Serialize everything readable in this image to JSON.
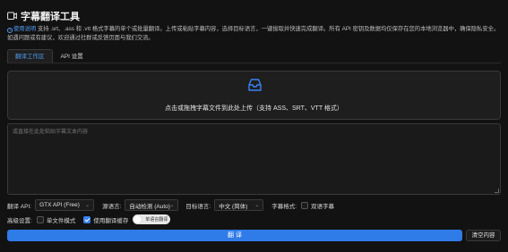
{
  "header": {
    "title": "字幕翻译工具",
    "icon": "subtitle-icon"
  },
  "description": {
    "help_link": "使用说明",
    "text": "支持 .srt、.ass 和 .vtt 格式字幕的单个或批量翻译。上传或粘贴字幕内容，选择目标语言，一键拔取并快速完成翻译。所有 API 密钥及数据均仅保存在您的本地浏览器中，确保隐私安全。如遇问题或有建议，欢迎通过社群或反馈页面与我们交流。"
  },
  "tabs": [
    {
      "label": "翻译工作区",
      "active": true
    },
    {
      "label": "API 设置",
      "active": false
    }
  ],
  "dropzone": {
    "text": "点击或拖拽字幕文件到此处上传（支持 ASS、SRT、VTT 格式）",
    "icon": "inbox-icon"
  },
  "textarea": {
    "placeholder": "或直接在此处粘贴字幕文本内容"
  },
  "settings": {
    "api_label": "翻译 API:",
    "api_value": "GTX API (Free)",
    "source_label": "源语言:",
    "source_value": "自动检测 (Auto)",
    "target_label": "目标语言:",
    "target_value": "中文 (简体)",
    "format_label": "字幕格式:",
    "bilingual_label": "双语字幕",
    "advanced_label": "高级设置:",
    "single_file_label": "单文件模式",
    "cache_label": "使用翻译缓存",
    "toggle_label": "单语言翻译"
  },
  "buttons": {
    "translate": "翻 译",
    "clear": "清空内容"
  },
  "colors": {
    "accent": "#2f7be8",
    "link": "#4f9cf0",
    "background": "#121212"
  }
}
